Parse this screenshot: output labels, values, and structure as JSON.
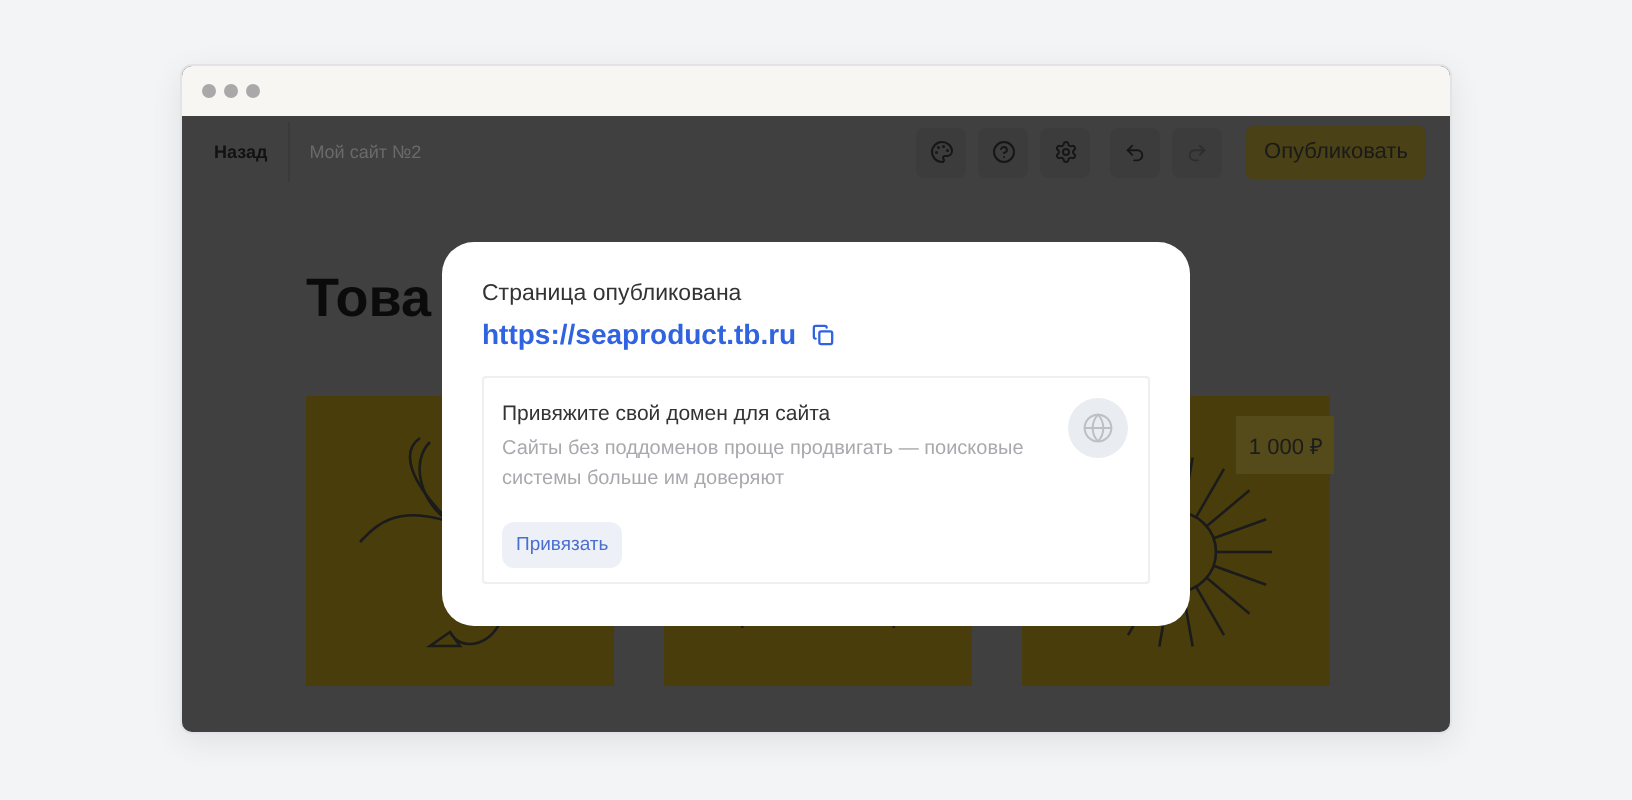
{
  "toolbar": {
    "back": "Назад",
    "site_name_placeholder": "Мой сайт №2",
    "publish": "Опубликовать"
  },
  "page": {
    "heading": "Това",
    "products": [
      {
        "kind": "shrimp"
      },
      {
        "kind": "crab"
      },
      {
        "kind": "urchin",
        "price": "1 000 ₽"
      }
    ]
  },
  "modal": {
    "title": "Страница опубликована",
    "url": "https://seaproduct.tb.ru",
    "domain_card": {
      "title": "Привяжите свой домен для сайта",
      "description": "Сайты без поддоменов проще продвигать — поисковые системы больше им доверяют",
      "button": "Привязать"
    }
  }
}
